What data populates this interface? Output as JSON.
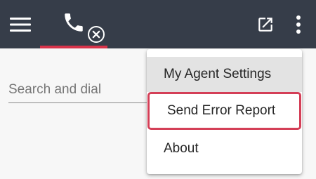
{
  "topbar": {
    "background": "#363d49",
    "menu_icon": "hamburger-menu-icon",
    "active_tab": {
      "icon": "phone-icon",
      "status_badge_icon": "close-circle-icon",
      "indicator_color": "#d8334a"
    },
    "popout_icon": "open-in-new-icon",
    "more_icon": "more-vertical-icon"
  },
  "search": {
    "placeholder": "Search and dial",
    "value": ""
  },
  "dropdown_menu": {
    "items": [
      {
        "label": "My Agent Settings",
        "state": "hovered"
      },
      {
        "label": "Send Error Report",
        "state": "highlighted",
        "highlight_color": "#d43f57"
      },
      {
        "label": "About",
        "state": "normal"
      }
    ]
  }
}
